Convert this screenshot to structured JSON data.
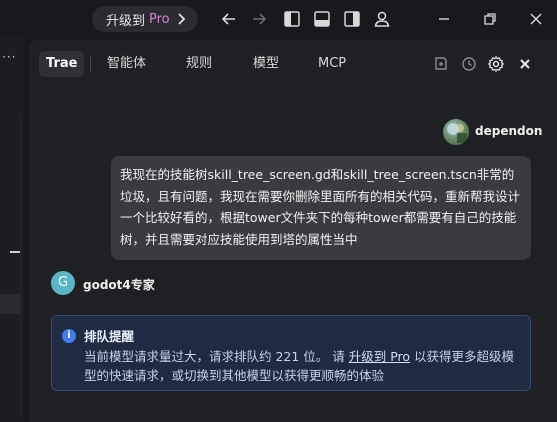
{
  "titlebar": {
    "upgrade_text": "升级到",
    "upgrade_pro": "Pro",
    "icons": [
      "chevron-right-icon",
      "back-arrow-icon",
      "forward-arrow-icon",
      "layout-left-icon",
      "layout-bottom-icon",
      "layout-right-icon",
      "account-icon",
      "minimize-icon",
      "restore-icon",
      "close-icon"
    ]
  },
  "left_strip": {
    "dots": "···"
  },
  "tabs": [
    {
      "label": "Trae",
      "active": true
    },
    {
      "label": "智能体"
    },
    {
      "label": "规则"
    },
    {
      "label": "模型"
    },
    {
      "label": "MCP"
    }
  ],
  "panel_icons": [
    "new-chat-icon",
    "history-icon",
    "settings-icon",
    "close-icon"
  ],
  "user": {
    "name": "dependon",
    "message": "我现在的技能树skill_tree_screen.gd和skill_tree_screen.tscn非常的垃圾，且有问题，我现在需要你删除里面所有的相关代码，重新帮我设计一个比较好看的，根据tower文件夹下的每种tower都需要有自己的技能树，并且需要对应技能使用到塔的属性当中"
  },
  "assistant": {
    "avatar_letter": "G",
    "name": "godot4专家"
  },
  "notice": {
    "title": "排队提醒",
    "body_before": "当前模型请求量过大，请求排队约 221 位。 请 ",
    "link": "升级到 Pro",
    "body_after": " 以获得更多超级模型的快速请求，或切换到其他模型以获得更顺畅的体验",
    "color": "#3f7cf0"
  }
}
